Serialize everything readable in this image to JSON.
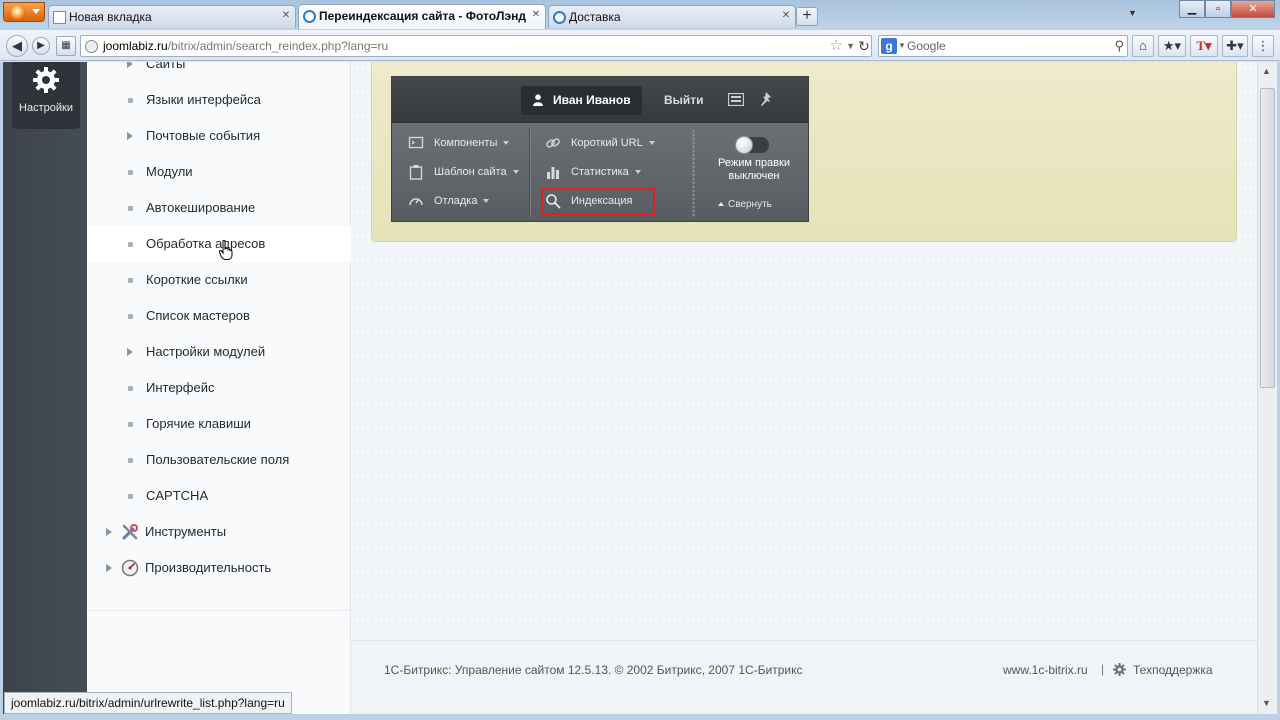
{
  "browser": {
    "tabs": [
      {
        "label": "Новая вкладка",
        "active": false
      },
      {
        "label": "Переиндексация сайта - ФотоЛэнд",
        "active": true
      },
      {
        "label": "Доставка",
        "active": false
      }
    ],
    "url_host": "joomlabiz.ru",
    "url_path": "/bitrix/admin/search_reindex.php?lang=ru",
    "search_placeholder": "Google",
    "status_url": "joomlabiz.ru/bitrix/admin/urlrewrite_list.php?lang=ru"
  },
  "leftbar": {
    "settings_label": "Настройки"
  },
  "menu": {
    "items": [
      {
        "label": "Сайты",
        "kind": "expandable"
      },
      {
        "label": "Языки интерфейса",
        "kind": "leaf"
      },
      {
        "label": "Почтовые события",
        "kind": "expandable"
      },
      {
        "label": "Модули",
        "kind": "leaf"
      },
      {
        "label": "Автокеширование",
        "kind": "leaf"
      },
      {
        "label": "Обработка адресов",
        "kind": "leaf"
      },
      {
        "label": "Короткие ссылки",
        "kind": "leaf"
      },
      {
        "label": "Список мастеров",
        "kind": "leaf"
      },
      {
        "label": "Настройки модулей",
        "kind": "expandable"
      },
      {
        "label": "Интерфейс",
        "kind": "leaf"
      },
      {
        "label": "Горячие клавиши",
        "kind": "leaf"
      },
      {
        "label": "Пользовательские поля",
        "kind": "leaf"
      },
      {
        "label": "CAPTCHA",
        "kind": "leaf"
      },
      {
        "label": "Инструменты",
        "kind": "top"
      },
      {
        "label": "Производительность",
        "kind": "top"
      }
    ]
  },
  "panel": {
    "user_name": "Иван Иванов",
    "logout_label": "Выйти",
    "components_label": "Компоненты",
    "template_label": "Шаблон сайта",
    "debug_label": "Отладка",
    "short_url_label": "Короткий URL",
    "stats_label": "Статистика",
    "index_label": "Индексация",
    "edit_mode_line1": "Режим правки",
    "edit_mode_line2": "выключен",
    "collapse_label": "Свернуть"
  },
  "footer": {
    "copyright": "1С-Битрикс: Управление сайтом 12.5.13. © 2002 Битрикс, 2007 1С-Битрикс",
    "site_link": "www.1c-bitrix.ru",
    "separator": "|",
    "support_label": "Техподдержка"
  },
  "colors": {
    "highlight_border": "#e01f1f",
    "panel_bg": "#5b6167",
    "notice_bg": "#eeeacb"
  }
}
